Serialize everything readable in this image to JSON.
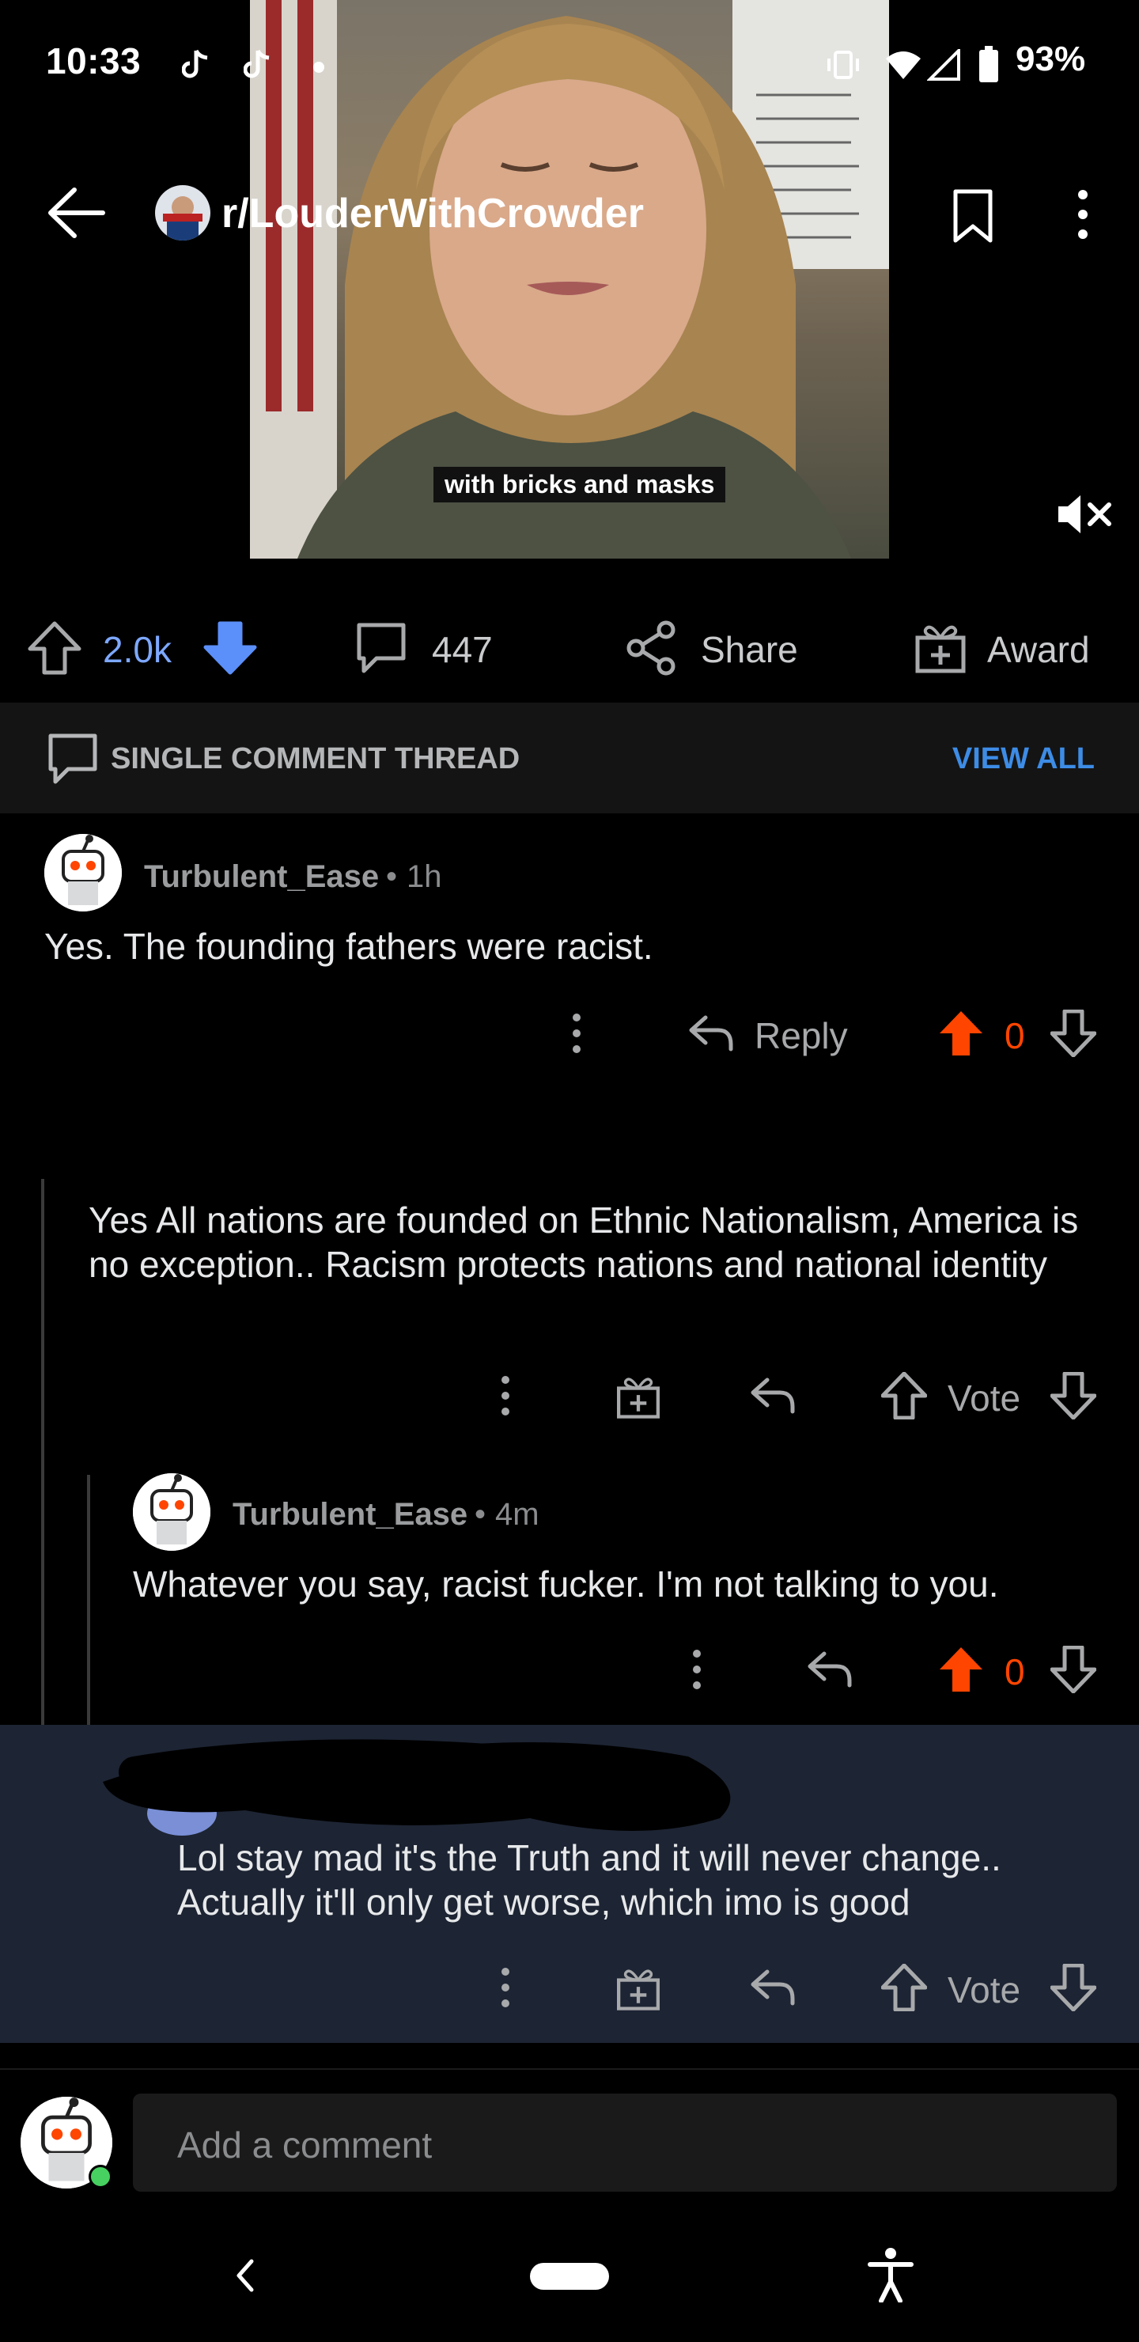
{
  "status": {
    "time": "10:33",
    "battery": "93%"
  },
  "header": {
    "subreddit": "r/LouderWithCrowder"
  },
  "video": {
    "caption": "with bricks and masks"
  },
  "post_actions": {
    "score": "2.0k",
    "comments": "447",
    "share": "Share",
    "award": "Award"
  },
  "thread_bar": {
    "label": "SINGLE COMMENT THREAD",
    "view_all": "VIEW ALL"
  },
  "comments": [
    {
      "author": "Turbulent_Ease",
      "age": "1h",
      "text": "Yes. The founding fathers were racist.",
      "reply": "Reply",
      "score": "0"
    },
    {
      "text": "Yes All nations are founded on Ethnic Nationalism, America is no exception.. Racism protects nations and national identity",
      "vote": "Vote"
    },
    {
      "author": "Turbulent_Ease",
      "age": "4m",
      "text": "Whatever you say, racist fucker. I'm not talking to you.",
      "score": "0"
    },
    {
      "text": "Lol stay mad it's the Truth and it will never change.. Actually it'll only get worse, which imo is good",
      "vote": "Vote"
    }
  ],
  "composer": {
    "placeholder": "Add a comment"
  },
  "colors": {
    "upvote": "#ff4500",
    "link": "#3d8ce6",
    "score": "#7da8ff",
    "highlight": "#1d2433"
  }
}
